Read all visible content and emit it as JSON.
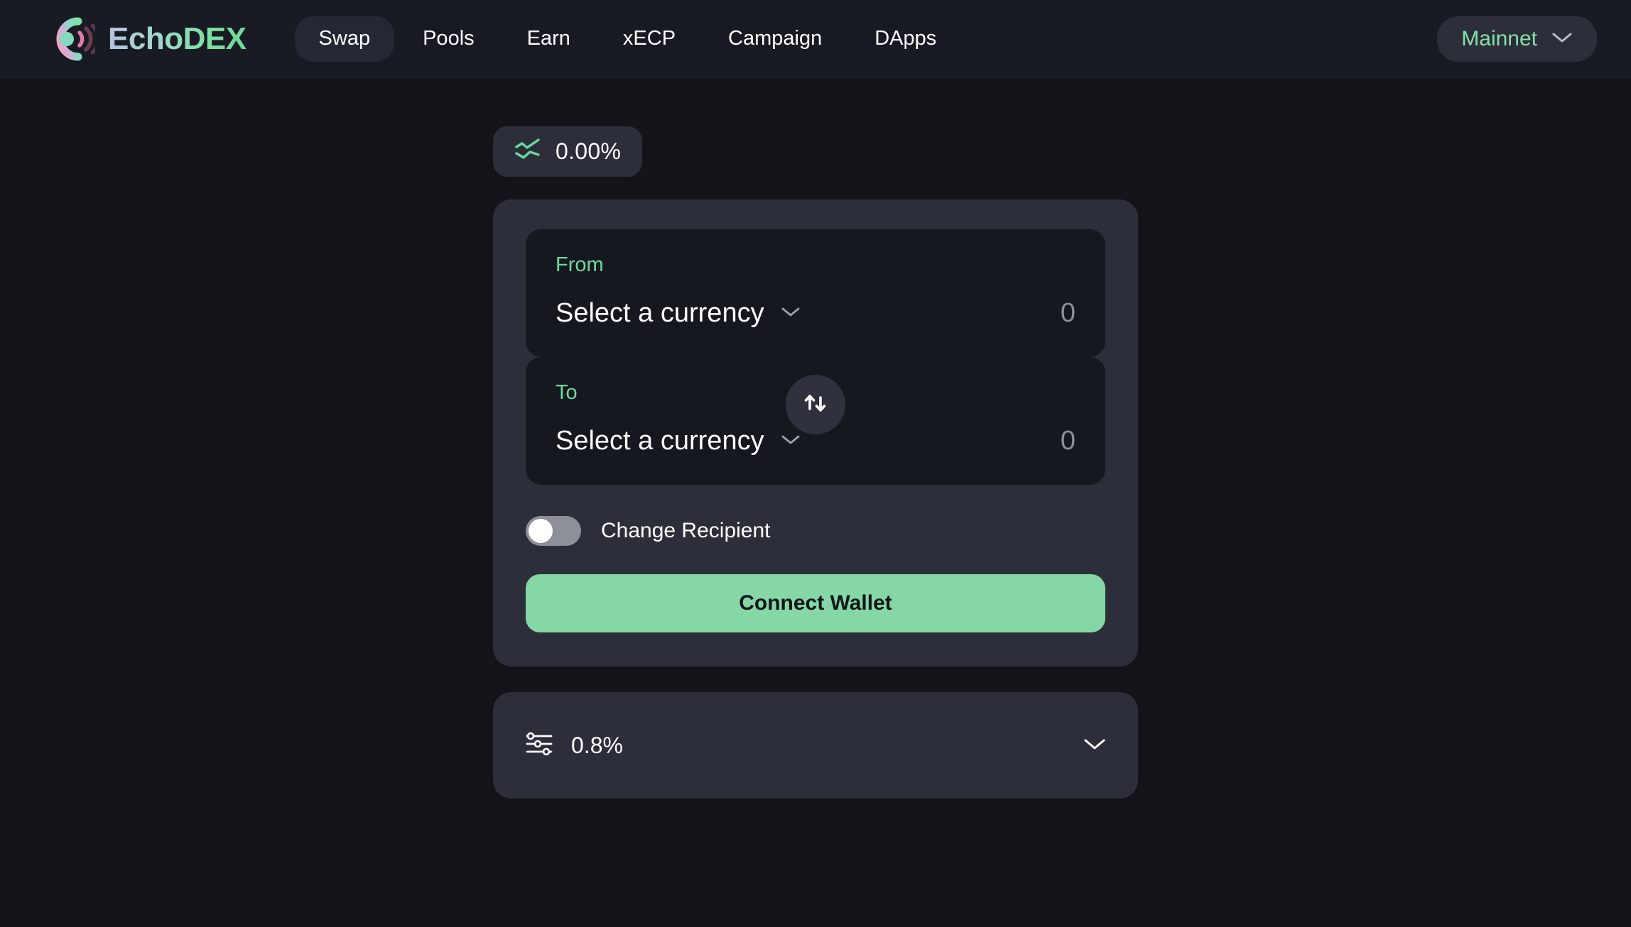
{
  "header": {
    "brand": {
      "name": "EchoDEX",
      "logo_icon": "echo-logo-icon"
    },
    "nav": [
      {
        "label": "Swap",
        "active": true
      },
      {
        "label": "Pools",
        "active": false
      },
      {
        "label": "Earn",
        "active": false
      },
      {
        "label": "xECP",
        "active": false
      },
      {
        "label": "Campaign",
        "active": false
      },
      {
        "label": "DApps",
        "active": false
      }
    ],
    "network": {
      "label": "Mainnet",
      "chevron_icon": "chevron-down-icon"
    }
  },
  "main": {
    "rate_chip": {
      "icon": "price-chart-icon",
      "value": "0.00%"
    },
    "swap": {
      "from": {
        "label": "From",
        "currency_text": "Select a currency",
        "chevron_icon": "chevron-down-icon",
        "amount_value": "",
        "amount_placeholder": "0"
      },
      "to": {
        "label": "To",
        "currency_text": "Select a currency",
        "chevron_icon": "chevron-down-icon",
        "amount_value": "",
        "amount_placeholder": "0"
      },
      "swap_direction_icon": "swap-vertical-arrows-icon",
      "recipient": {
        "label": "Change Recipient",
        "enabled": false
      },
      "connect_label": "Connect Wallet"
    },
    "settings": {
      "icon": "sliders-icon",
      "slippage": "0.8%",
      "chevron_icon": "chevron-down-icon"
    }
  },
  "colors": {
    "page_bg": "#121419",
    "header_bg": "#181b23",
    "card_bg": "#2c2f39",
    "panel_bg": "#15181f",
    "accent_green": "#6fd8a0",
    "button_green": "#85d8a5",
    "network_green": "#86dfab",
    "muted_text": "#8a8f99"
  }
}
